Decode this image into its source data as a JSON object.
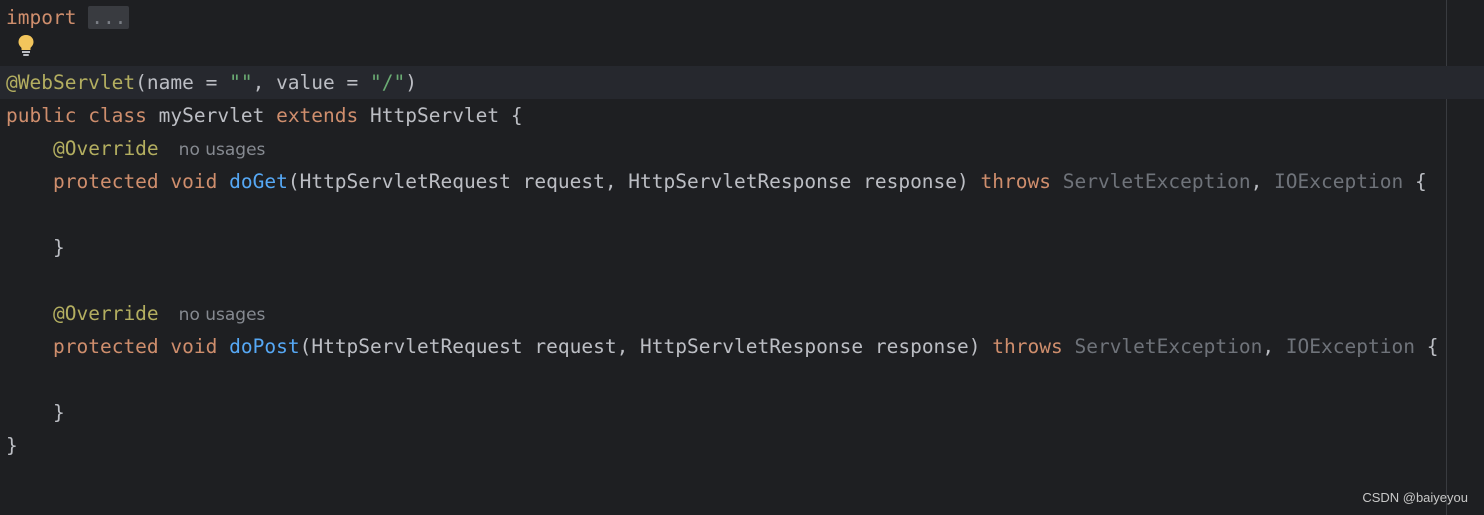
{
  "editor": {
    "lines": {
      "import": {
        "keyword": "import",
        "folded": "..."
      },
      "annotation": {
        "at_name": "@WebServlet",
        "paren_open": "(",
        "name_attr": "name",
        "eq1": " = ",
        "name_val": "\"\"",
        "comma": ", ",
        "value_attr": "value",
        "eq2": " = ",
        "value_val": "\"/\"",
        "paren_close": ")"
      },
      "class_decl": {
        "public": "public",
        "class": "class",
        "name": "myServlet",
        "extends": "extends",
        "parent": "HttpServlet",
        "brace": "{"
      },
      "override1": {
        "annotation": "@Override",
        "hint": "no usages"
      },
      "doget": {
        "protected": "protected",
        "void": "void",
        "method": "doGet",
        "params": "(HttpServletRequest request, HttpServletResponse response)",
        "throws": "throws",
        "ex1": "ServletException",
        "comma": ", ",
        "ex2": "IOException",
        "brace": "{"
      },
      "close1": "}",
      "override2": {
        "annotation": "@Override",
        "hint": "no usages"
      },
      "dopost": {
        "protected": "protected",
        "void": "void",
        "method": "doPost",
        "params": "(HttpServletRequest request, HttpServletResponse response)",
        "throws": "throws",
        "ex1": "ServletException",
        "comma": ", ",
        "ex2": "IOException",
        "brace": "{"
      },
      "close2": "}",
      "close_class": "}"
    },
    "intention_icon": "lightbulb-icon"
  },
  "watermark": "CSDN @baiyeyou",
  "colors": {
    "background": "#1e1f22",
    "keyword": "#cf8e6d",
    "annotation": "#b3ae60",
    "string": "#6aab73",
    "method": "#56a8f5",
    "unused": "#6f737a",
    "text": "#bcbec4"
  }
}
